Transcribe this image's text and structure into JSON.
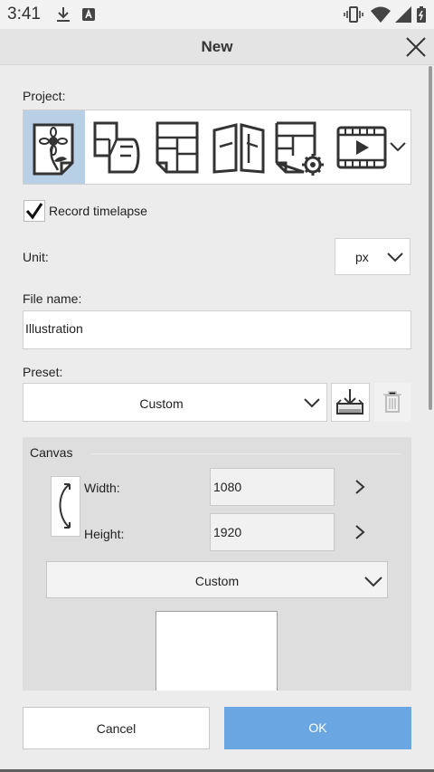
{
  "status_bar": {
    "time": "3:41"
  },
  "dialog": {
    "title": "New"
  },
  "project": {
    "label": "Project:",
    "items": [
      {
        "name": "illustration",
        "selected": true
      },
      {
        "name": "comic",
        "selected": false
      },
      {
        "name": "page",
        "selected": false
      },
      {
        "name": "book",
        "selected": false
      },
      {
        "name": "page-settings",
        "selected": false
      },
      {
        "name": "animation",
        "selected": false
      }
    ]
  },
  "record_timelapse": {
    "label": "Record timelapse",
    "checked": true
  },
  "unit": {
    "label": "Unit:",
    "value": "px"
  },
  "file_name": {
    "label": "File name:",
    "value": "Illustration"
  },
  "preset": {
    "label": "Preset:",
    "value": "Custom"
  },
  "canvas": {
    "title": "Canvas",
    "width_label": "Width:",
    "width_value": "1080",
    "height_label": "Height:",
    "height_value": "1920",
    "size_preset": "Custom"
  },
  "buttons": {
    "cancel": "Cancel",
    "ok": "OK"
  },
  "colors": {
    "accent": "#6aa7e2",
    "selected_tile": "#b9cfe6"
  }
}
